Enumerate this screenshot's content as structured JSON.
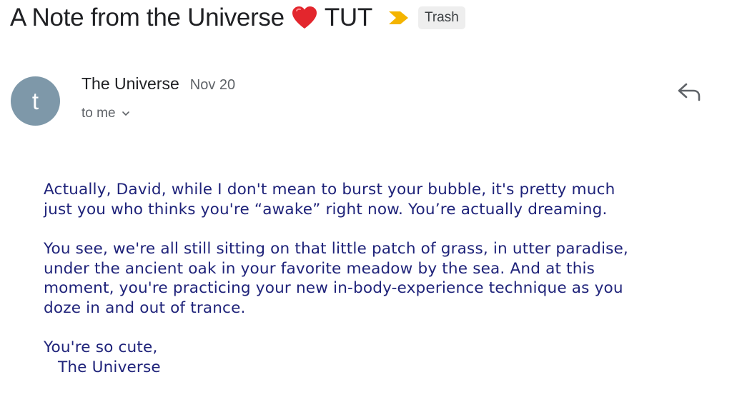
{
  "subject": {
    "title_part1": "A Note from the Universe",
    "heart_icon": "red-heart-icon",
    "title_part2": "TUT",
    "importance_icon": "importance-marker-icon",
    "importance_color": "#f4b400",
    "label": "Trash"
  },
  "sender": {
    "avatar_letter": "t",
    "avatar_color": "#7e98a9",
    "name": "The Universe",
    "date": "Nov 20",
    "recipient": "to me",
    "reply_icon": "reply-icon"
  },
  "message": {
    "para1_line1": "Actually, David, while I don't mean to burst your bubble, it's pretty much",
    "para1_line2": "just you who thinks you're “awake” right now. You’re actually dreaming.",
    "para2_line1": "You see, we're all still sitting on that little patch of grass, in utter paradise,",
    "para2_line2": "under the ancient oak in your favorite meadow by the sea. And at this",
    "para2_line3": "moment, you're practicing your new in-body-experience technique as you",
    "para2_line4": "doze in and out of trance.",
    "closing": "You're so cute,",
    "signature": "The Universe",
    "text_color": "#1f237a"
  }
}
